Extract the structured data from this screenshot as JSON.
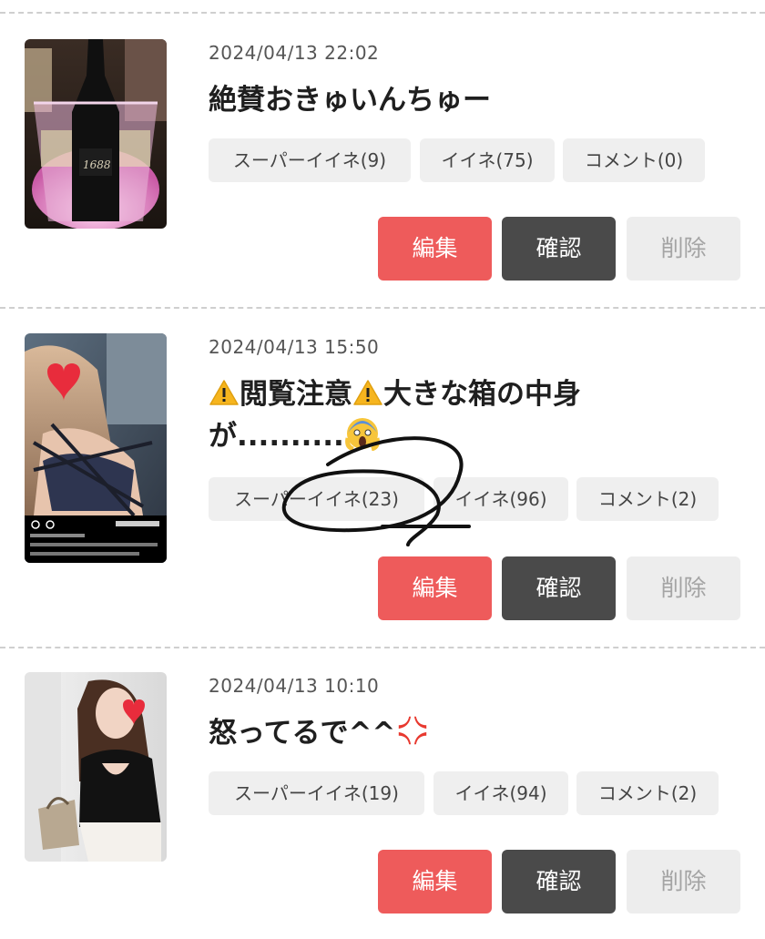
{
  "posts": [
    {
      "date": "2024/04/13 22:02",
      "title": "絶賛おきゅいんちゅー",
      "super_like": "スーパーイイネ(9)",
      "like": "イイネ(75)",
      "comment": "コメント(0)",
      "thumbnail": "champagne-bottle-photo"
    },
    {
      "date": "2024/04/13 15:50",
      "title_part1": "閲覧注意",
      "title_part2": "大きな箱の中身",
      "title_line2": "が..........",
      "super_like": "スーパーイイネ(23)",
      "like": "イイネ(96)",
      "comment": "コメント(2)",
      "thumbnail": "woman-selfie-photo",
      "warning_icon": "warning-icon",
      "face_icon": "screaming-face-icon"
    },
    {
      "date": "2024/04/13 10:10",
      "title": "怒ってるで^^",
      "super_like": "スーパーイイネ(19)",
      "like": "イイネ(94)",
      "comment": "コメント(2)",
      "thumbnail": "woman-mirror-photo",
      "anger_icon": "anger-symbol-icon"
    }
  ],
  "buttons": {
    "edit": "編集",
    "confirm": "確認",
    "delete": "削除"
  },
  "colors": {
    "edit": "#ee5b5b",
    "confirm": "#4a4a4a",
    "delete_bg": "#ededed",
    "tag_bg": "#efefef"
  }
}
